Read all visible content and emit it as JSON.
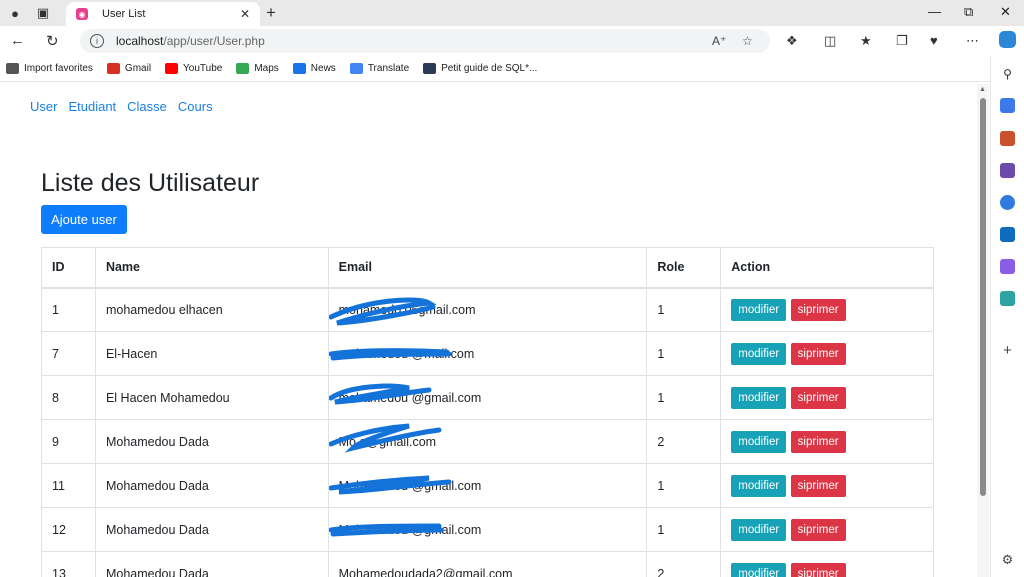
{
  "browser": {
    "tab_title": "User List",
    "url_host": "localhost",
    "url_path": "/app/user/User.php"
  },
  "bookmarks": [
    {
      "label": "Import favorites",
      "icon": "import-icon",
      "color": "#555555"
    },
    {
      "label": "Gmail",
      "icon": "gmail-icon",
      "color": "#d93025"
    },
    {
      "label": "YouTube",
      "icon": "youtube-icon",
      "color": "#ff0000"
    },
    {
      "label": "Maps",
      "icon": "maps-icon",
      "color": "#34a853"
    },
    {
      "label": "News",
      "icon": "news-icon",
      "color": "#1a73e8"
    },
    {
      "label": "Translate",
      "icon": "translate-icon",
      "color": "#4285f4"
    },
    {
      "label": "Petit guide de SQL*...",
      "icon": "sql-icon",
      "color": "#2b3a55"
    }
  ],
  "nav": [
    "User",
    "Etudiant",
    "Classe",
    "Cours"
  ],
  "page": {
    "title": "Liste des Utilisateur",
    "add_button": "Ajoute user"
  },
  "table": {
    "headers": [
      "ID",
      "Name",
      "Email",
      "Role",
      "Action"
    ],
    "rows": [
      {
        "id": "1",
        "name": "mohamedou elhacen",
        "email": "mohamedo 06gmail.com",
        "role": "1"
      },
      {
        "id": "7",
        "name": "El-Hacen",
        "email": "mohamedou @mail.com",
        "role": "1"
      },
      {
        "id": "8",
        "name": "El Hacen Mohamedou",
        "email": "mohamedou @gmail.com",
        "role": "1"
      },
      {
        "id": "9",
        "name": "Mohamedou Dada",
        "email": "Mo a@gmail.com",
        "role": "2"
      },
      {
        "id": "11",
        "name": "Mohamedou Dada",
        "email": "Mohamedou @gmail.com",
        "role": "1"
      },
      {
        "id": "12",
        "name": "Mohamedou Dada",
        "email": "Mohamedou @gmail.com",
        "role": "1"
      },
      {
        "id": "13",
        "name": "Mohamedou Dada",
        "email": "Mohamedoudada2@gmail.com",
        "role": "2"
      }
    ],
    "modify_label": "modifier",
    "delete_label": "siprimer"
  },
  "colors": {
    "link": "#1a7fe0",
    "primary": "#0d7dfd",
    "info": "#17a2b8",
    "danger": "#dc3545",
    "scribble": "#1473d8"
  }
}
